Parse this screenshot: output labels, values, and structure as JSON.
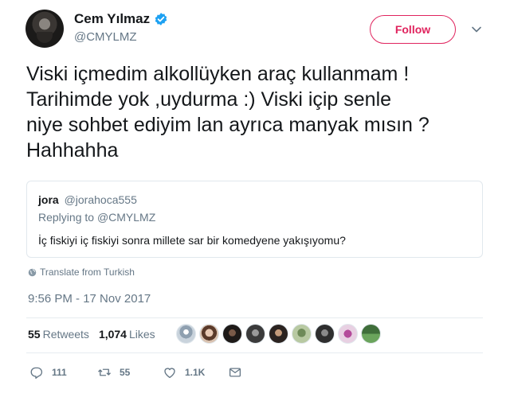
{
  "user": {
    "display_name": "Cem Yılmaz",
    "handle": "@CMYLMZ",
    "verified_icon": "verified-badge-icon",
    "follow_label": "Follow",
    "accent_color": "#e0245e"
  },
  "tweet": {
    "text_lines": [
      "Viski içmedim alkollüyken araç kullanmam !",
      "Tarihimde yok ,uydurma :) Viski içip senle",
      "niye sohbet ediyim lan ayrıca manyak mısın ?",
      "Hahhahha"
    ],
    "translate_label": "Translate from Turkish",
    "timestamp": "9:56 PM - 17 Nov 2017"
  },
  "quoted_tweet": {
    "name": "jora",
    "handle": "@jorahoca555",
    "replying_prefix": "Replying to",
    "replying_to": "@CMYLMZ",
    "text": "İç fiskiyi iç fiskiyi sonra millete sar bir komedyene yakışıyomu?"
  },
  "stats": {
    "retweets_count": "55",
    "retweets_label": "Retweets",
    "likes_count": "1,074",
    "likes_label": "Likes"
  },
  "actions": {
    "reply_count": "111",
    "retweet_count": "55",
    "like_count": "1.1K"
  }
}
